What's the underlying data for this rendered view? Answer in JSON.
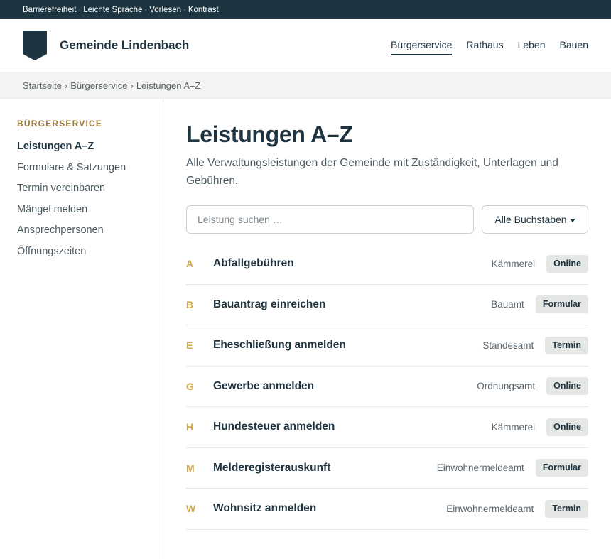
{
  "utility_bar": {
    "items": [
      "Barrierefreiheit",
      "Leichte Sprache",
      "Vorlesen",
      "Kontrast"
    ],
    "separator": "·"
  },
  "header": {
    "site_name": "Gemeinde Lindenbach",
    "crest_icon": "shield-crest-icon",
    "nav": [
      {
        "label": "Bürgerservice",
        "active": true
      },
      {
        "label": "Rathaus",
        "active": false
      },
      {
        "label": "Leben",
        "active": false
      },
      {
        "label": "Bauen",
        "active": false
      }
    ]
  },
  "breadcrumb": {
    "items": [
      "Startseite",
      "Bürgerservice",
      "Leistungen A–Z"
    ],
    "separator": "›"
  },
  "sidebar": {
    "title": "BÜRGERSERVICE",
    "items": [
      {
        "label": "Leistungen A–Z",
        "active": true
      },
      {
        "label": "Formulare & Satzungen",
        "active": false
      },
      {
        "label": "Termin vereinbaren",
        "active": false
      },
      {
        "label": "Mängel melden",
        "active": false
      },
      {
        "label": "Ansprechpersonen",
        "active": false
      },
      {
        "label": "Öffnungszeiten",
        "active": false
      }
    ]
  },
  "main": {
    "title": "Leistungen A–Z",
    "lead": "Alle Verwaltungsleistungen der Gemeinde mit Zuständigkeit, Unterlagen und Gebühren.",
    "search": {
      "placeholder": "Leistung suchen …",
      "value": ""
    },
    "letter_filter": {
      "selected": "Alle Buchstaben",
      "icon": "caret-down-icon"
    },
    "services": [
      {
        "letter": "A",
        "name": "Abfallgebühren",
        "office": "Kämmerei",
        "badge": "Online"
      },
      {
        "letter": "B",
        "name": "Bauantrag einreichen",
        "office": "Bauamt",
        "badge": "Formular"
      },
      {
        "letter": "E",
        "name": "Eheschließung anmelden",
        "office": "Standesamt",
        "badge": "Termin"
      },
      {
        "letter": "G",
        "name": "Gewerbe anmelden",
        "office": "Ordnungsamt",
        "badge": "Online"
      },
      {
        "letter": "H",
        "name": "Hundesteuer anmelden",
        "office": "Kämmerei",
        "badge": "Online"
      },
      {
        "letter": "M",
        "name": "Melderegisterauskunft",
        "office": "Einwohnermeldeamt",
        "badge": "Formular"
      },
      {
        "letter": "W",
        "name": "Wohnsitz anmelden",
        "office": "Einwohnermeldeamt",
        "badge": "Termin"
      }
    ]
  },
  "colors": {
    "primary": "#1d3541",
    "accent_gold": "#d0a84a",
    "sidebar_title": "#9a7a3c",
    "badge_bg": "#e4e7e4",
    "breadcrumb_bg": "#f3f3f1"
  }
}
